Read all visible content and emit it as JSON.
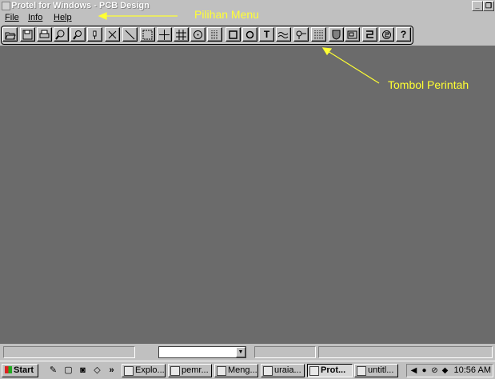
{
  "window": {
    "title": "Protel for Windows - PCB Design",
    "min_glyph": "_",
    "restore_glyph": "❐"
  },
  "menu": [
    "File",
    "Info",
    "Help"
  ],
  "annotations": {
    "menu": "Pilihan Menu",
    "toolbar": "Tombol Perintah",
    "color": "#ffff33"
  },
  "toolbar": {
    "buttons": [
      {
        "icon": "open-folder-icon"
      },
      {
        "icon": "save-disk-icon"
      },
      {
        "icon": "print-icon"
      },
      {
        "icon": "zoom-in-icon"
      },
      {
        "icon": "zoom-out-icon"
      },
      {
        "icon": "pick-hand-icon"
      },
      {
        "icon": "scissors-icon"
      },
      {
        "icon": "track-line-icon"
      },
      {
        "icon": "select-box-icon"
      },
      {
        "icon": "crosshair-icon"
      },
      {
        "icon": "grid-icon"
      },
      {
        "icon": "arc-icon"
      },
      {
        "icon": "component-icon"
      },
      {
        "icon": "square-pad-icon"
      },
      {
        "icon": "round-pad-icon"
      },
      {
        "icon": "text-icon",
        "glyph": "T"
      },
      {
        "icon": "wave-icon"
      },
      {
        "icon": "via-icon"
      },
      {
        "icon": "ic-footprint-icon"
      },
      {
        "icon": "shield-icon"
      },
      {
        "icon": "board-icon"
      },
      {
        "icon": "route-icon"
      },
      {
        "icon": "autoroute-icon"
      },
      {
        "icon": "help-icon",
        "glyph": "?"
      }
    ]
  },
  "statusbar": {
    "combo_value": "",
    "combo_arrow": "▼"
  },
  "taskbar": {
    "start_label": "Start",
    "quicklaunch_more": "»",
    "tasks": [
      {
        "label": "Explo...",
        "active": false
      },
      {
        "label": "pemr...",
        "active": false
      },
      {
        "label": "Meng...",
        "active": false
      },
      {
        "label": "uraia...",
        "active": false
      },
      {
        "label": "Prot...",
        "active": true
      },
      {
        "label": "untitl...",
        "active": false
      }
    ],
    "clock": "10:56 AM"
  }
}
